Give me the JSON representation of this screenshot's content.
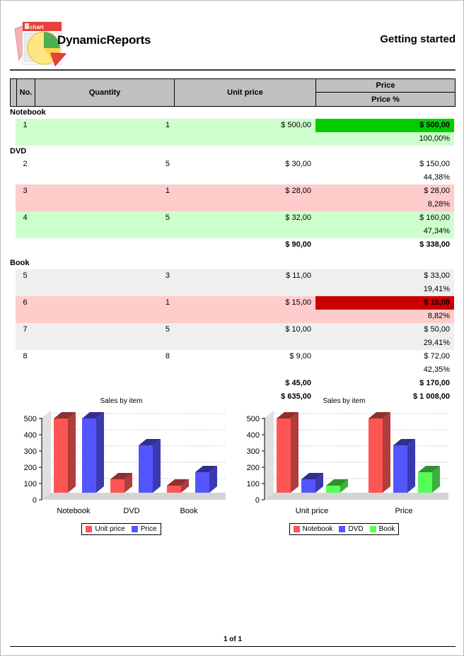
{
  "header": {
    "brand": "DynamicReports",
    "right_title": "Getting started",
    "logo_icon": "chart-document-pie-icon"
  },
  "table": {
    "columns": [
      "No.",
      "Quantity",
      "Unit price",
      "Price"
    ],
    "sub_column": "Price %",
    "groups": [
      {
        "name": "Notebook",
        "rows": [
          {
            "no": "1",
            "quantity": "1",
            "unit_price": "$ 500,00",
            "price": "$ 500,00",
            "price_pct": "100,00%",
            "row_style": "green",
            "price_style": "max"
          }
        ],
        "subtotal": null
      },
      {
        "name": "DVD",
        "rows": [
          {
            "no": "2",
            "quantity": "5",
            "unit_price": "$ 30,00",
            "price": "$ 150,00",
            "price_pct": "44,38%",
            "row_style": "plain",
            "price_style": "none"
          },
          {
            "no": "3",
            "quantity": "1",
            "unit_price": "$ 28,00",
            "price": "$ 28,00",
            "price_pct": "8,28%",
            "row_style": "pink",
            "price_style": "none"
          },
          {
            "no": "4",
            "quantity": "5",
            "unit_price": "$ 32,00",
            "price": "$ 160,00",
            "price_pct": "47,34%",
            "row_style": "green",
            "price_style": "none"
          }
        ],
        "subtotal": {
          "unit_price": "$ 90,00",
          "price": "$ 338,00"
        }
      },
      {
        "name": "Book",
        "rows": [
          {
            "no": "5",
            "quantity": "3",
            "unit_price": "$ 11,00",
            "price": "$ 33,00",
            "price_pct": "19,41%",
            "row_style": "grey",
            "price_style": "none"
          },
          {
            "no": "6",
            "quantity": "1",
            "unit_price": "$ 15,00",
            "price": "$ 15,00",
            "price_pct": "8,82%",
            "row_style": "pink",
            "price_style": "min"
          },
          {
            "no": "7",
            "quantity": "5",
            "unit_price": "$ 10,00",
            "price": "$ 50,00",
            "price_pct": "29,41%",
            "row_style": "grey",
            "price_style": "none"
          },
          {
            "no": "8",
            "quantity": "8",
            "unit_price": "$ 9,00",
            "price": "$ 72,00",
            "price_pct": "42,35%",
            "row_style": "plain",
            "price_style": "none"
          }
        ],
        "subtotal": {
          "unit_price": "$ 45,00",
          "price": "$ 170,00"
        }
      }
    ],
    "grand_total": {
      "unit_price": "$ 635,00",
      "price": "$ 1 008,00"
    }
  },
  "colors": {
    "header_bg": "#c0c0c0",
    "row_green": "#ccffcc",
    "row_pink": "#ffcccc",
    "row_grey": "#efefef",
    "max_cell": "#00cc00",
    "min_cell": "#cc0000",
    "series_red": "#ff5555",
    "series_blue": "#5555ff",
    "series_green": "#55ff55"
  },
  "chart_data": [
    {
      "type": "bar",
      "title": "Sales by item",
      "xlabel": "",
      "ylabel": "",
      "categories": [
        "Notebook",
        "DVD",
        "Book"
      ],
      "series": [
        {
          "name": "Unit price",
          "color": "#ff5555",
          "values": [
            500,
            90,
            45
          ]
        },
        {
          "name": "Price",
          "color": "#5555ff",
          "values": [
            500,
            338,
            170
          ]
        }
      ],
      "yticks": [
        0,
        100,
        200,
        300,
        400,
        500
      ],
      "ylim": [
        0,
        560
      ],
      "grid": true,
      "legend_position": "bottom",
      "three_d": true
    },
    {
      "type": "bar",
      "title": "Sales by item",
      "xlabel": "",
      "ylabel": "",
      "categories": [
        "Unit price",
        "Price"
      ],
      "series": [
        {
          "name": "Notebook",
          "color": "#ff5555",
          "values": [
            500,
            500
          ]
        },
        {
          "name": "DVD",
          "color": "#5555ff",
          "values": [
            90,
            338
          ]
        },
        {
          "name": "Book",
          "color": "#55ff55",
          "values": [
            45,
            170
          ]
        }
      ],
      "yticks": [
        0,
        100,
        200,
        300,
        400,
        500
      ],
      "ylim": [
        0,
        560
      ],
      "grid": true,
      "legend_position": "bottom",
      "three_d": true
    }
  ],
  "footer": {
    "page_label": "1 of 1"
  }
}
